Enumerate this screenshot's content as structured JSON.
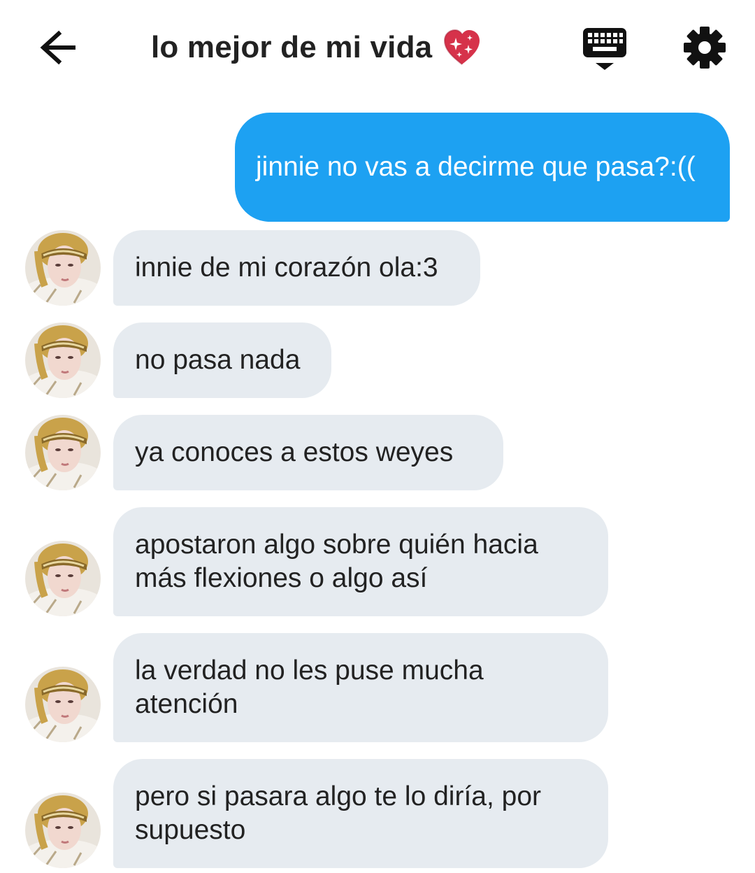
{
  "header": {
    "title": "lo mejor de mi vida",
    "icons": {
      "back": "arrow-left-icon",
      "title_emoji": "sparkling-heart-icon",
      "keyboard": "keyboard-icon",
      "settings": "gear-icon"
    }
  },
  "messages": [
    {
      "from": "me",
      "text": "jinnie no vas a decirme que pasa?:(("
    },
    {
      "from": "contact",
      "text": "innie de mi corazón ola:3"
    },
    {
      "from": "contact",
      "text": "no pasa nada"
    },
    {
      "from": "contact",
      "text": "ya conoces a estos weyes"
    },
    {
      "from": "contact",
      "text": "apostaron algo sobre quién hacia más flexiones o algo así"
    },
    {
      "from": "contact",
      "text": "la verdad no les puse mucha atención"
    },
    {
      "from": "contact",
      "text": "pero si pasara algo te lo diría, por supuesto"
    }
  ],
  "colors": {
    "sent_bubble": "#1da1f2",
    "received_bubble": "#e6ebf0",
    "text_dark": "#222222",
    "text_light": "#ffffff",
    "heart": "#d6324a"
  }
}
